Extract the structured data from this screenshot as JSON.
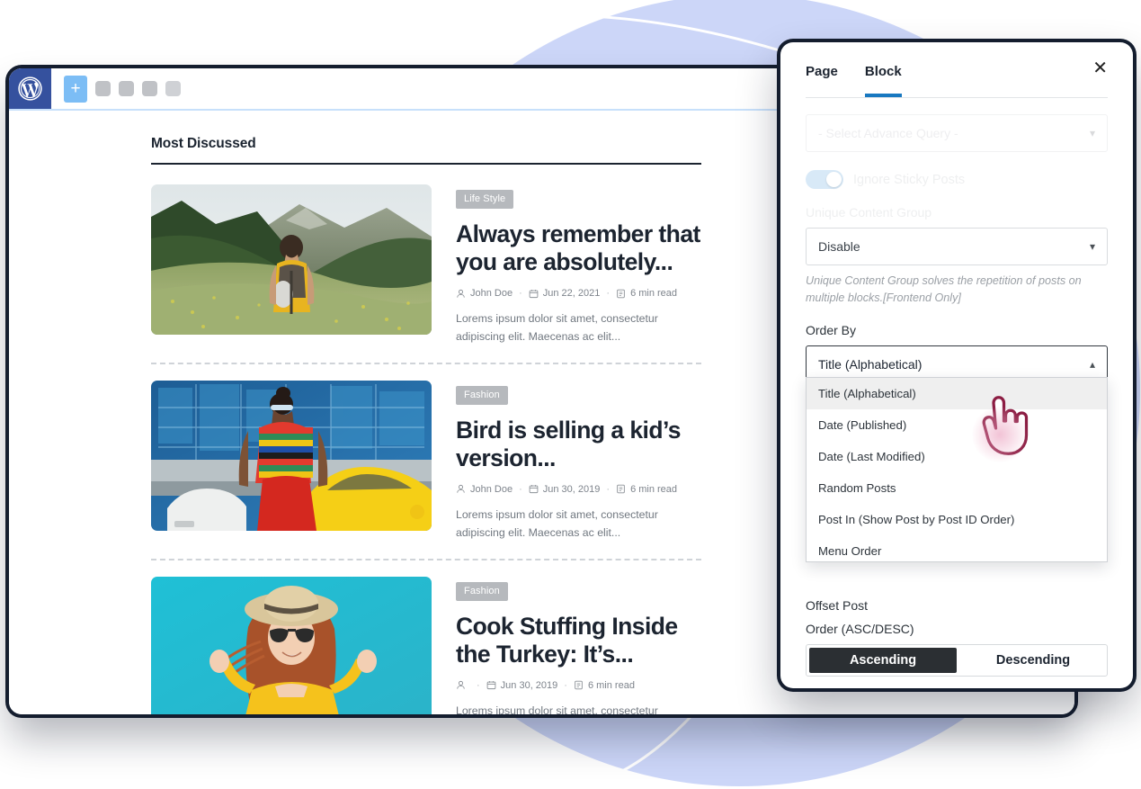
{
  "editor": {
    "toolbar": {
      "wp_logo": "wordpress-logo",
      "add_block_label": "+",
      "ghost_buttons": [
        "tool-1",
        "tool-2",
        "tool-3",
        "tool-4"
      ],
      "settings_icon": "layout-settings-icon"
    },
    "section_title": "Most Discussed",
    "posts": [
      {
        "category": "Life Style",
        "title": "Always remember that you are absolutely...",
        "author": "John Doe",
        "date": "Jun 22, 2021",
        "read_time": "6 min read",
        "excerpt": "Lorems ipsum dolor sit amet, consectetur adipiscing elit. Maecenas ac elit...",
        "image": "hiker-in-mountain-valley"
      },
      {
        "category": "Fashion",
        "title": "Bird is selling a kid’s version...",
        "author": "John Doe",
        "date": "Jun 30, 2019",
        "read_time": "6 min read",
        "excerpt": "Lorems ipsum dolor sit amet, consectetur adipiscing elit. Maecenas ac elit...",
        "image": "woman-rainbow-sweater-city"
      },
      {
        "category": "Fashion",
        "title": "Cook Stuffing Inside the Turkey: It’s...",
        "author": "",
        "date": "Jun 30, 2019",
        "read_time": "6 min read",
        "excerpt": "Lorems ipsum dolor sit amet, consectetur adipiscing elit. Maecenas ac elit...",
        "image": "woman-hat-teal-background"
      }
    ]
  },
  "panel": {
    "tabs": [
      {
        "label": "Page",
        "active": false
      },
      {
        "label": "Block",
        "active": true
      }
    ],
    "close_label": "✕",
    "advance_query": {
      "value": "- Select Advance Query -",
      "chevron": "chevron-down-icon"
    },
    "ignore_sticky": {
      "label": "Ignore Sticky Posts",
      "state": "on"
    },
    "unique_content_group": {
      "label": "Unique Content Group",
      "value": "Disable",
      "help": "Unique Content Group solves the repetition of posts on multiple blocks.[Frontend Only]"
    },
    "order_by": {
      "label": "Order By",
      "value": "Title (Alphabetical)",
      "chevron": "chevron-up-icon",
      "options": [
        "Title (Alphabetical)",
        "Date (Published)",
        "Date (Last Modified)",
        "Random Posts",
        "Post In (Show Post by Post ID Order)",
        "Menu Order"
      ],
      "highlighted": "Title (Alphabetical)"
    },
    "offset_post_label": "Offset Post",
    "order_direction": {
      "label": "Order (ASC/DESC)",
      "ascending": "Ascending",
      "descending": "Descending",
      "selected": "Ascending"
    }
  },
  "colors": {
    "accent_blue": "#1878c0",
    "wp_navy": "#35519e",
    "bg_ellipse": "#b9c6f5",
    "dark_frame": "#141d2e",
    "cursor_outline": "#8c1d43"
  }
}
